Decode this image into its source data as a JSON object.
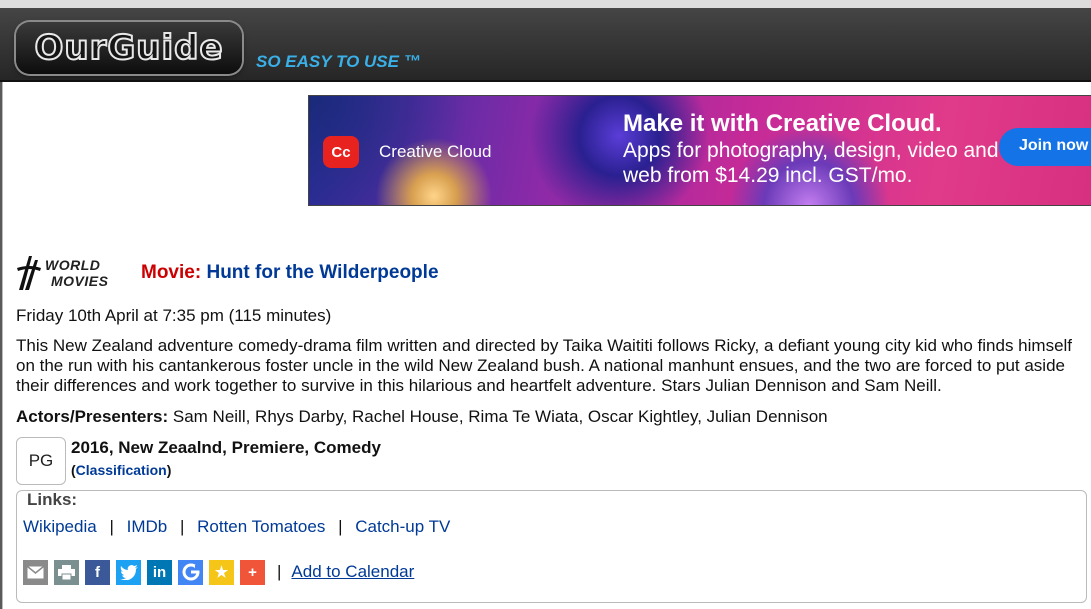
{
  "header": {
    "logo_text": "OurGuide",
    "tagline": "SO EASY TO USE ™"
  },
  "ad": {
    "brand": "Creative Cloud",
    "headline": "Make it with Creative Cloud.",
    "subtext": "Apps for photography, design, video and web from $14.29 incl. GST/mo.",
    "cta": "Join now"
  },
  "channel": {
    "logo_line1": "WORLD",
    "logo_line2": "MOVIES"
  },
  "program": {
    "type_label": "Movie:",
    "title": "Hunt for the Wilderpeople",
    "airtime": "Friday 10th April at 7:35 pm (115 minutes)",
    "synopsis": "This New Zealand adventure comedy-drama film written and directed by Taika Waititi follows Ricky, a defiant young city kid who finds himself on the run with his cantankerous foster uncle in the wild New Zealand bush. A national manhunt ensues, and the two are forced to put aside their differences and work together to survive in this hilarious and heartfelt adventure. Stars Julian Dennison and Sam Neill.",
    "actors_label": "Actors/Presenters:",
    "actors": "Sam Neill, Rhys Darby, Rachel House, Rima Te Wiata, Oscar Kightley, Julian Dennison",
    "rating": "PG",
    "meta": "2016, New Zeaalnd, Premiere, Comedy",
    "classification_link": "Classification"
  },
  "links": {
    "legend": "Links:",
    "items": [
      "Wikipedia",
      "IMDb",
      "Rotten Tomatoes",
      "Catch-up TV"
    ],
    "separator": "|",
    "calendar": "Add to Calendar"
  },
  "share": {
    "icons": [
      {
        "name": "email-icon",
        "color": "#8a8a8a"
      },
      {
        "name": "print-icon",
        "color": "#7a8f8f"
      },
      {
        "name": "facebook-icon",
        "color": "#3b5998"
      },
      {
        "name": "twitter-icon",
        "color": "#1da1f2"
      },
      {
        "name": "linkedin-icon",
        "color": "#0077b5"
      },
      {
        "name": "google-icon",
        "color": "#4285f4"
      },
      {
        "name": "favorite-star-icon",
        "color": "#f5c518"
      },
      {
        "name": "more-plus-icon",
        "color": "#f0553a"
      }
    ]
  }
}
